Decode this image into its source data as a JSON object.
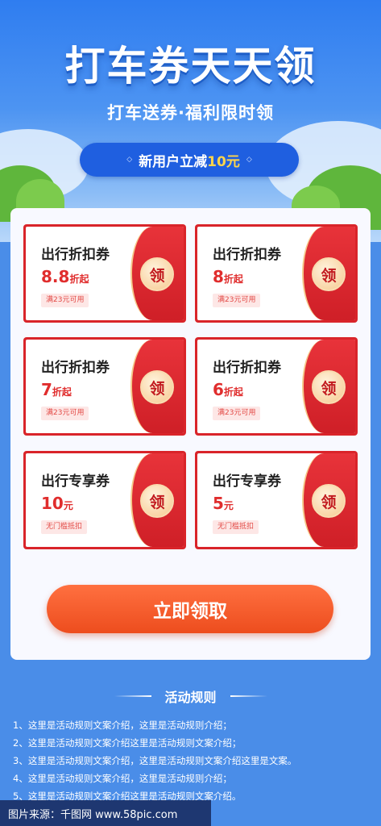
{
  "hero": {
    "title": "打车券天天领",
    "subtitle": "打车送券·福利限时领",
    "pill_prefix": "新用户立减",
    "pill_highlight": "10元",
    "pill_ornament": "◇"
  },
  "coupons": [
    {
      "name": "出行折扣券",
      "value": "8.8",
      "unit": "折起",
      "condition": "满23元可用",
      "button": "领"
    },
    {
      "name": "出行折扣券",
      "value": "8",
      "unit": "折起",
      "condition": "满23元可用",
      "button": "领"
    },
    {
      "name": "出行折扣券",
      "value": "7",
      "unit": "折起",
      "condition": "满23元可用",
      "button": "领"
    },
    {
      "name": "出行折扣券",
      "value": "6",
      "unit": "折起",
      "condition": "满23元可用",
      "button": "领"
    },
    {
      "name": "出行专享券",
      "value": "10",
      "unit": "元",
      "condition": "无门槛抵扣",
      "button": "领"
    },
    {
      "name": "出行专享券",
      "value": "5",
      "unit": "元",
      "condition": "无门槛抵扣",
      "button": "领"
    }
  ],
  "cta": {
    "label": "立即领取"
  },
  "rules": {
    "title": "活动规则",
    "items": [
      "1、这里是活动规则文案介绍，这里是活动规则介绍；",
      "2、这里是活动规则文案介绍这里是活动规则文案介绍；",
      "3、这里是活动规则文案介绍，这里是活动规则文案介绍这里是文案。",
      "4、这里是活动规则文案介绍，这里是活动规则介绍；",
      "5、这里是活动规则文案介绍这里是活动规则文案介绍。"
    ]
  },
  "watermark": "图片来源：千图网 www.58pic.com",
  "colors": {
    "accent": "#2f7df0",
    "coupon_red": "#d9242a",
    "cta_orange": "#ed4d1e"
  }
}
